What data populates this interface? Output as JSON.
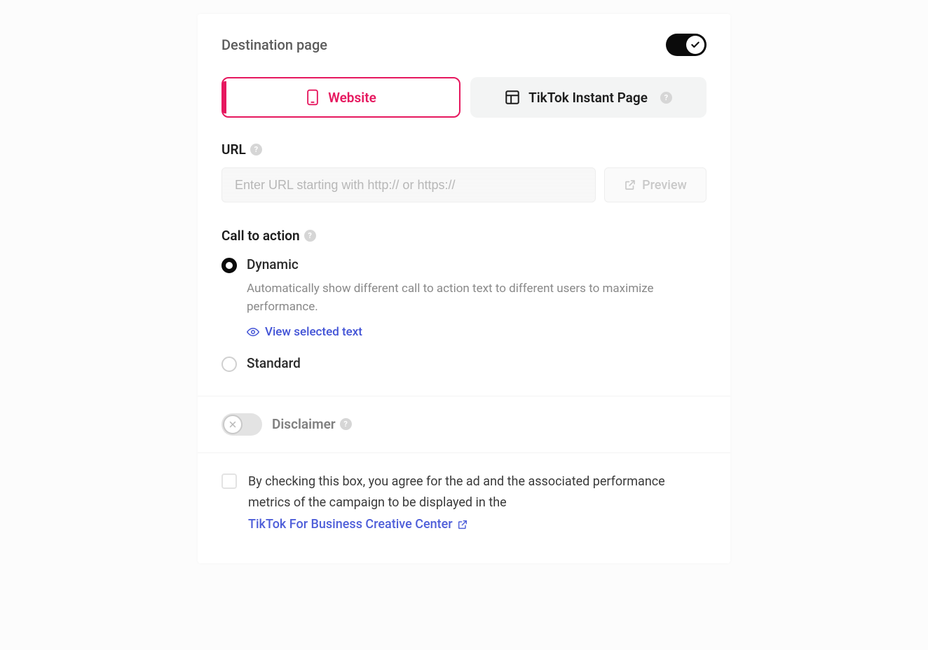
{
  "destination": {
    "title": "Destination page",
    "toggle_on": true,
    "options": {
      "website": "Website",
      "instant_page": "TikTok Instant Page"
    }
  },
  "url": {
    "label": "URL",
    "placeholder": "Enter URL starting with http:// or https://",
    "preview_label": "Preview"
  },
  "cta": {
    "label": "Call to action",
    "dynamic": {
      "title": "Dynamic",
      "description": "Automatically show different call to action text to different users to maximize performance.",
      "view_link": "View selected text"
    },
    "standard": {
      "title": "Standard"
    }
  },
  "disclaimer": {
    "label": "Disclaimer"
  },
  "agreement": {
    "text_prefix": "By checking this box, you agree for the ad and the associated performance metrics of the campaign to be displayed in the ",
    "link_text": "TikTok For Business Creative Center"
  }
}
